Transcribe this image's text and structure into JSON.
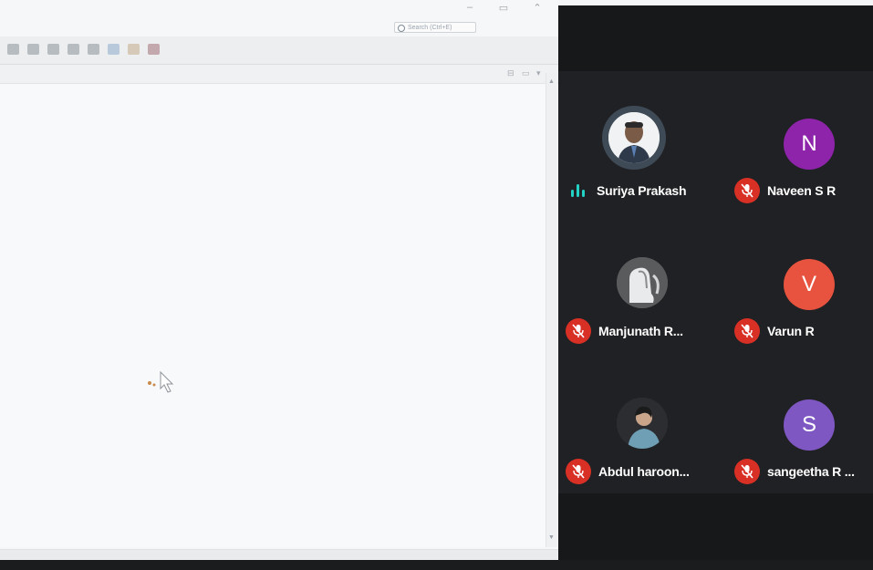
{
  "app": {
    "search_placeholder": "Search (Ctrl+E)",
    "window_controls": [
      "–",
      "▭",
      "⌃"
    ],
    "toolbar_icons": [
      "toolbar-tool-1-icon",
      "toolbar-tool-2-icon",
      "toolbar-tool-3-icon",
      "toolbar-tool-4-icon",
      "toolbar-tool-5-icon",
      "toolbar-tool-6-icon",
      "toolbar-tool-7-icon",
      "toolbar-tool-8-icon"
    ]
  },
  "meeting": {
    "participants": [
      {
        "name": "Suriya Prakash",
        "avatar_letter": "",
        "avatar_type": "photo",
        "audio": "speaking"
      },
      {
        "name": "Naveen S R",
        "avatar_letter": "N",
        "avatar_color": "#8e24aa",
        "audio": "muted"
      },
      {
        "name": "Manjunath R...",
        "avatar_letter": "",
        "avatar_type": "photo",
        "audio": "muted"
      },
      {
        "name": "Varun R",
        "avatar_letter": "V",
        "avatar_color": "#e8533f",
        "audio": "muted"
      },
      {
        "name": "Abdul haroon...",
        "avatar_letter": "",
        "avatar_type": "photo",
        "audio": "muted"
      },
      {
        "name": "sangeetha R ...",
        "avatar_letter": "S",
        "avatar_color": "#7e57c2",
        "audio": "muted"
      }
    ],
    "colors": {
      "panel_bg": "#202124",
      "mic_off": "#d93025",
      "speaking": "#22d3c5"
    }
  }
}
